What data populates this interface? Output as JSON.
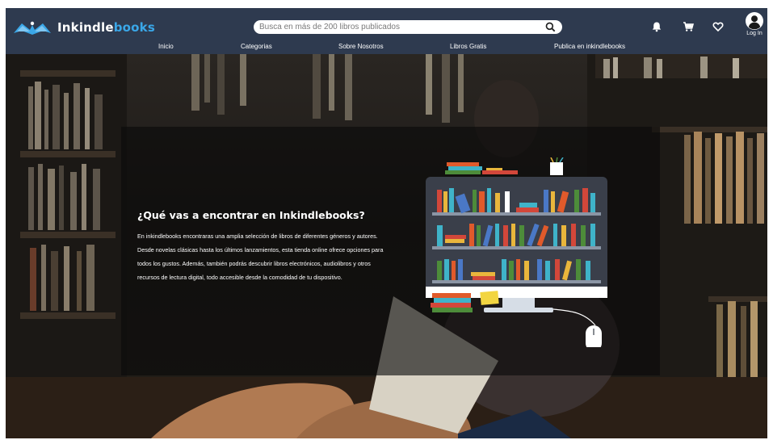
{
  "brand": {
    "name_part1": "Inkindle",
    "name_part2": "books"
  },
  "search": {
    "placeholder": "Busca en más de 200 libros publicados"
  },
  "header_icons": [
    "bell-icon",
    "cart-icon",
    "heart-icon",
    "user-icon"
  ],
  "login": {
    "label": "Log In"
  },
  "nav": {
    "items": [
      {
        "label": "Inicio"
      },
      {
        "label": "Categorias"
      },
      {
        "label": "Sobre Nosotros"
      },
      {
        "label": "Libros Gratis"
      },
      {
        "label": "Publica en inkindlebooks"
      }
    ]
  },
  "hero": {
    "title": "¿Qué vas a encontrar en Inkindlebooks?",
    "body": "En inkindlebooks encontraras una amplia selección de libros de diferentes géneros y autores. Desde novelas clásicas hasta los últimos lanzamientos, esta tienda online ofrece opciones para todos los gustos. Además, también podrás descubrir libros electrónicos, audiolibros y otros recursos de lectura digital, todo accesible desde la comodidad de tu dispositivo."
  },
  "colors": {
    "header_bg": "#2e3a4f",
    "brand_accent": "#3aa7e8",
    "panel_overlay": "rgba(10,10,10,0.62)"
  }
}
